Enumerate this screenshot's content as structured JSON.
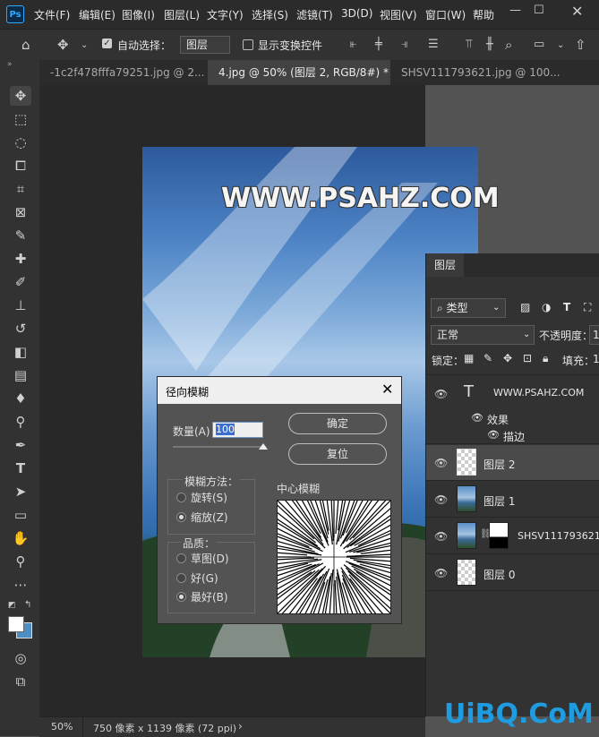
{
  "app": {
    "logo": "Ps",
    "menu": [
      "文件(F)",
      "编辑(E)",
      "图像(I)",
      "图层(L)",
      "文字(Y)",
      "选择(S)",
      "滤镜(T)",
      "3D(D)",
      "视图(V)",
      "窗口(W)",
      "帮助"
    ]
  },
  "options": {
    "auto_select_label": "自动选择：",
    "layer_select_value": "图层",
    "show_transform_label": "显示变换控件"
  },
  "tabs": [
    {
      "label": "-1c2f478fffa79251.jpg @ 2...",
      "active": false
    },
    {
      "label": "4.jpg @ 50% (图层 2, RGB/8#) *",
      "active": true
    },
    {
      "label": "SHSV111793621.jpg @ 100...",
      "active": false
    }
  ],
  "canvas": {
    "watermark_text": "WWW.PSAHZ.COM"
  },
  "dialog": {
    "title": "径向模糊",
    "amount_label": "数量(A)",
    "amount_value": "100",
    "ok_label": "确定",
    "reset_label": "复位",
    "blur_method_label": "模糊方法：",
    "blur_methods": [
      "旋转(S)",
      "缩放(Z)"
    ],
    "blur_method_selected": "缩放(Z)",
    "quality_label": "品质：",
    "qualities": [
      "草图(D)",
      "好(G)",
      "最好(B)"
    ],
    "quality_selected": "最好(B)",
    "center_label": "中心模糊"
  },
  "layers_panel": {
    "tab_label": "图层",
    "kind_label": "类型",
    "blend_mode": "正常",
    "opacity_label": "不透明度：",
    "opacity_value": "1",
    "lock_label": "锁定：",
    "fill_label": "填充：",
    "fill_value": "1",
    "text_layer_name": "WWW.PSAHZ.COM",
    "effects_label": "效果",
    "stroke_label": "描边",
    "layers": [
      {
        "name": "图层 2",
        "thumb": "checker",
        "selected": true
      },
      {
        "name": "图层 1",
        "thumb": "photo",
        "selected": false
      },
      {
        "name": "SHSV111793621",
        "thumb": "photo",
        "selected": false
      },
      {
        "name": "图层 0",
        "thumb": "checker",
        "selected": false
      }
    ]
  },
  "status": {
    "zoom": "50%",
    "doc_info": "750 像素 x 1139 像素 (72 ppi)"
  },
  "site_watermark": "UiBQ.CoM"
}
